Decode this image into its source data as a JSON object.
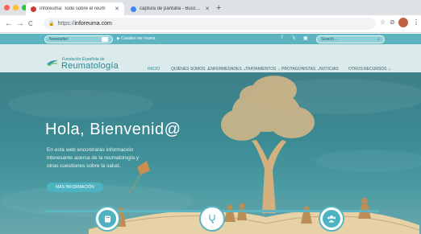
{
  "browser": {
    "tabs": [
      {
        "title": "Inforeuma: Todo sobre el reum",
        "active": true,
        "favicon_color": "#c63b3b"
      },
      {
        "title": "captura de pantalla - Buscar c",
        "active": false,
        "favicon_color": "#4285f4"
      }
    ],
    "new_tab_label": "+",
    "url_prefix": "https://",
    "url_domain": "inforeuma.com",
    "nav": {
      "back": "←",
      "forward": "→",
      "reload": "C"
    },
    "toolbar_icons": {
      "star": "☆",
      "extensions": "⊘",
      "menu": "⋮"
    }
  },
  "site": {
    "topbar": {
      "newsletter_label": "Newsletter",
      "channel_label": "Canales ser reuma",
      "social_icons": [
        "f",
        "𝕏",
        "▣"
      ],
      "search_placeholder": "Search..."
    },
    "logo": {
      "top_line": "Fundación Española de",
      "main_line": "Reumatología"
    },
    "menu": [
      {
        "label": "INICIO",
        "active": true
      },
      {
        "label": "QUIÉNES SOMOS ⌄",
        "active": false
      },
      {
        "label": "ENFERMEDADES ⌄",
        "active": false
      },
      {
        "label": "TRATAMIENTOS ⌄",
        "active": false
      },
      {
        "label": "PROTAGONISTAS ⌄",
        "active": false
      },
      {
        "label": "NOTICIAS",
        "active": false
      },
      {
        "label": "OTROS RECURSOS ⌄",
        "active": false
      }
    ],
    "hero": {
      "title": "Hola, Bienvenid@",
      "text": "En esta web encontrarás información interesante acerca de la reumatología y otras cuestiones sobre la salud.",
      "button_label": "MÁS INFORMACIÓN"
    },
    "feature_icons": [
      "book-icon",
      "stethoscope-icon",
      "users-icon"
    ]
  }
}
